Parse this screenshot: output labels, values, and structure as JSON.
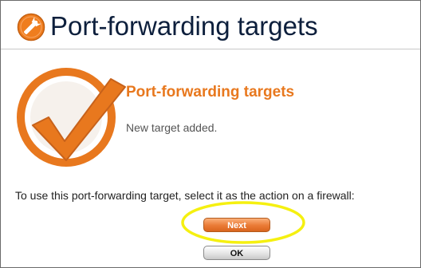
{
  "header": {
    "title": "Port-forwarding targets",
    "icon": "wrench-icon"
  },
  "main": {
    "subtitle": "Port-forwarding targets",
    "status": "New target added.",
    "instruction": "To use this port-forwarding target, select it as the action on a firewall:",
    "next_label": "Next",
    "ok_label": "OK"
  },
  "colors": {
    "accent_orange": "#e8781e",
    "title_navy": "#0d1f3c",
    "highlight_yellow": "#f5f010"
  }
}
